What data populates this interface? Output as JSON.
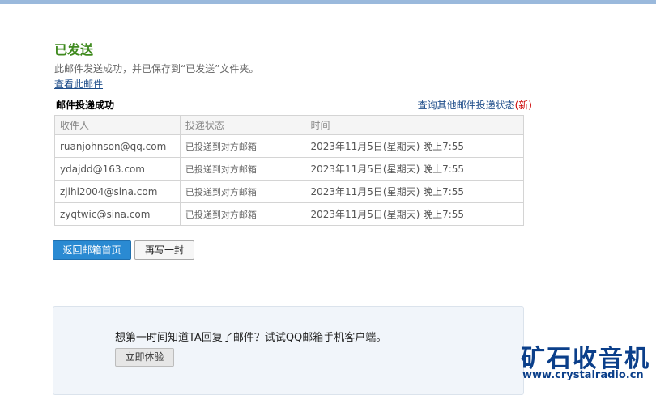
{
  "header": {
    "title": "已发送",
    "subtitle": "此邮件发送成功，并已保存到“已发送”文件夹。",
    "view_link": "查看此邮件"
  },
  "delivery": {
    "section_title": "邮件投递成功",
    "other_status_link": "查询其他邮件投递状态",
    "new_tag": "(新)",
    "columns": [
      "收件人",
      "投递状态",
      "时间"
    ],
    "rows": [
      {
        "recipient": "ruanjohnson@qq.com",
        "status": "已投递到对方邮箱",
        "time": "2023年11月5日(星期天) 晚上7:55"
      },
      {
        "recipient": "ydajdd@163.com",
        "status": "已投递到对方邮箱",
        "time": "2023年11月5日(星期天) 晚上7:55"
      },
      {
        "recipient": "zjlhl2004@sina.com",
        "status": "已投递到对方邮箱",
        "time": "2023年11月5日(星期天) 晚上7:55"
      },
      {
        "recipient": "zyqtwic@sina.com",
        "status": "已投递到对方邮箱",
        "time": "2023年11月5日(星期天) 晚上7:55"
      }
    ]
  },
  "actions": {
    "back_label": "返回邮箱首页",
    "compose_label": "再写一封"
  },
  "promo": {
    "text": "想第一时间知道TA回复了邮件？试试QQ邮箱手机客户端。",
    "button_label": "立即体验"
  },
  "watermark": {
    "name": "矿石收音机",
    "url": "www.crystalradio.cn"
  },
  "colors": {
    "title_green": "#3f8a1e",
    "link_blue": "#1e4d8a",
    "primary_button": "#2a8ad2",
    "new_red": "#cc0000"
  }
}
